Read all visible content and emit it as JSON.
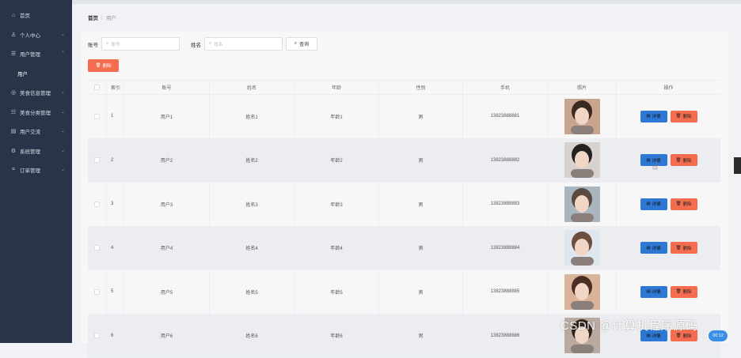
{
  "sidebar": {
    "items": [
      {
        "label": "首页",
        "icon": "home-icon",
        "glyph": "⌂",
        "chevron": ""
      },
      {
        "label": "个人中心",
        "icon": "user-icon",
        "glyph": "♙",
        "chevron": "⌄"
      },
      {
        "label": "用户管理",
        "icon": "menu-icon",
        "glyph": "☰",
        "chevron": "⌃"
      },
      {
        "label": "用户",
        "icon": "",
        "glyph": "",
        "chevron": ""
      },
      {
        "label": "美食信息管理",
        "icon": "food-icon",
        "glyph": "◎",
        "chevron": "⌄"
      },
      {
        "label": "美食分类管理",
        "icon": "category-icon",
        "glyph": "☷",
        "chevron": "⌄"
      },
      {
        "label": "用户交流",
        "icon": "chat-icon",
        "glyph": "▤",
        "chevron": "⌄"
      },
      {
        "label": "系统管理",
        "icon": "settings-icon",
        "glyph": "⚙",
        "chevron": "⌄"
      },
      {
        "label": "订单管理",
        "icon": "order-icon",
        "glyph": "⌗",
        "chevron": "⌄"
      }
    ]
  },
  "breadcrumb": {
    "home": "首页",
    "separator": "/",
    "current": "用户"
  },
  "search": {
    "account_label": "账号",
    "account_placeholder": "账号",
    "name_label": "姓名",
    "name_placeholder": "姓名",
    "query_label": "查询"
  },
  "toolbar": {
    "delete_label": "删除"
  },
  "table": {
    "headers": {
      "index": "索引",
      "account": "账号",
      "name": "姓名",
      "age": "年龄",
      "gender": "性别",
      "phone": "手机",
      "photo": "照片",
      "ops": "操作"
    },
    "detail_label": "详情",
    "delete_label": "删除",
    "rows": [
      {
        "index": "1",
        "account": "用户1",
        "name": "姓名1",
        "age": "年龄1",
        "gender": "男",
        "phone": "13823888881"
      },
      {
        "index": "2",
        "account": "用户2",
        "name": "姓名2",
        "age": "年龄2",
        "gender": "男",
        "phone": "13823888882"
      },
      {
        "index": "3",
        "account": "用户3",
        "name": "姓名3",
        "age": "年龄3",
        "gender": "男",
        "phone": "13823888883"
      },
      {
        "index": "4",
        "account": "用户4",
        "name": "姓名4",
        "age": "年龄4",
        "gender": "男",
        "phone": "13823888884"
      },
      {
        "index": "5",
        "account": "用户5",
        "name": "姓名5",
        "age": "年龄5",
        "gender": "男",
        "phone": "13823888885"
      },
      {
        "index": "6",
        "account": "用户6",
        "name": "姓名6",
        "age": "年龄6",
        "gender": "男",
        "phone": "13823888886"
      }
    ]
  },
  "overlay": {
    "watermark": "CSDN @计算机程序源码",
    "timer": "00:12"
  },
  "colors": {
    "sidebar": "#2a3448",
    "primary": "#2d78d4",
    "danger": "#f56c4e"
  }
}
